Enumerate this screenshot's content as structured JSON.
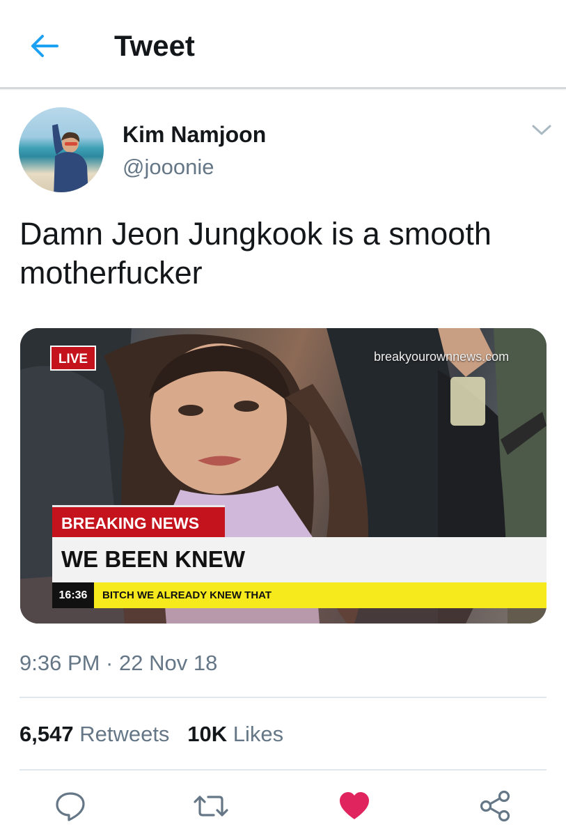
{
  "header": {
    "title": "Tweet",
    "back_icon": "back-arrow-icon",
    "accent_color": "#1da1f2"
  },
  "tweet": {
    "author": {
      "name": "Kim Namjoon",
      "handle": "@jooonie"
    },
    "text": "Damn Jeon Jungkook is a smooth motherfucker",
    "media": {
      "live_label": "LIVE",
      "watermark": "breakyourownnews.com",
      "breaking_label": "BREAKING NEWS",
      "headline": "WE BEEN KNEW",
      "ticker_time": "16:36",
      "ticker_text": "BITCH WE ALREADY KNEW THAT"
    },
    "timestamp": "9:36 PM · 22 Nov 18",
    "stats": {
      "retweets_count": "6,547",
      "retweets_label": "Retweets",
      "likes_count": "10K",
      "likes_label": "Likes"
    }
  },
  "actions": [
    {
      "name": "reply",
      "icon": "reply-icon"
    },
    {
      "name": "retweet",
      "icon": "retweet-icon"
    },
    {
      "name": "like",
      "icon": "heart-icon",
      "active": true,
      "color": "#e0245e"
    },
    {
      "name": "share",
      "icon": "share-icon"
    }
  ]
}
